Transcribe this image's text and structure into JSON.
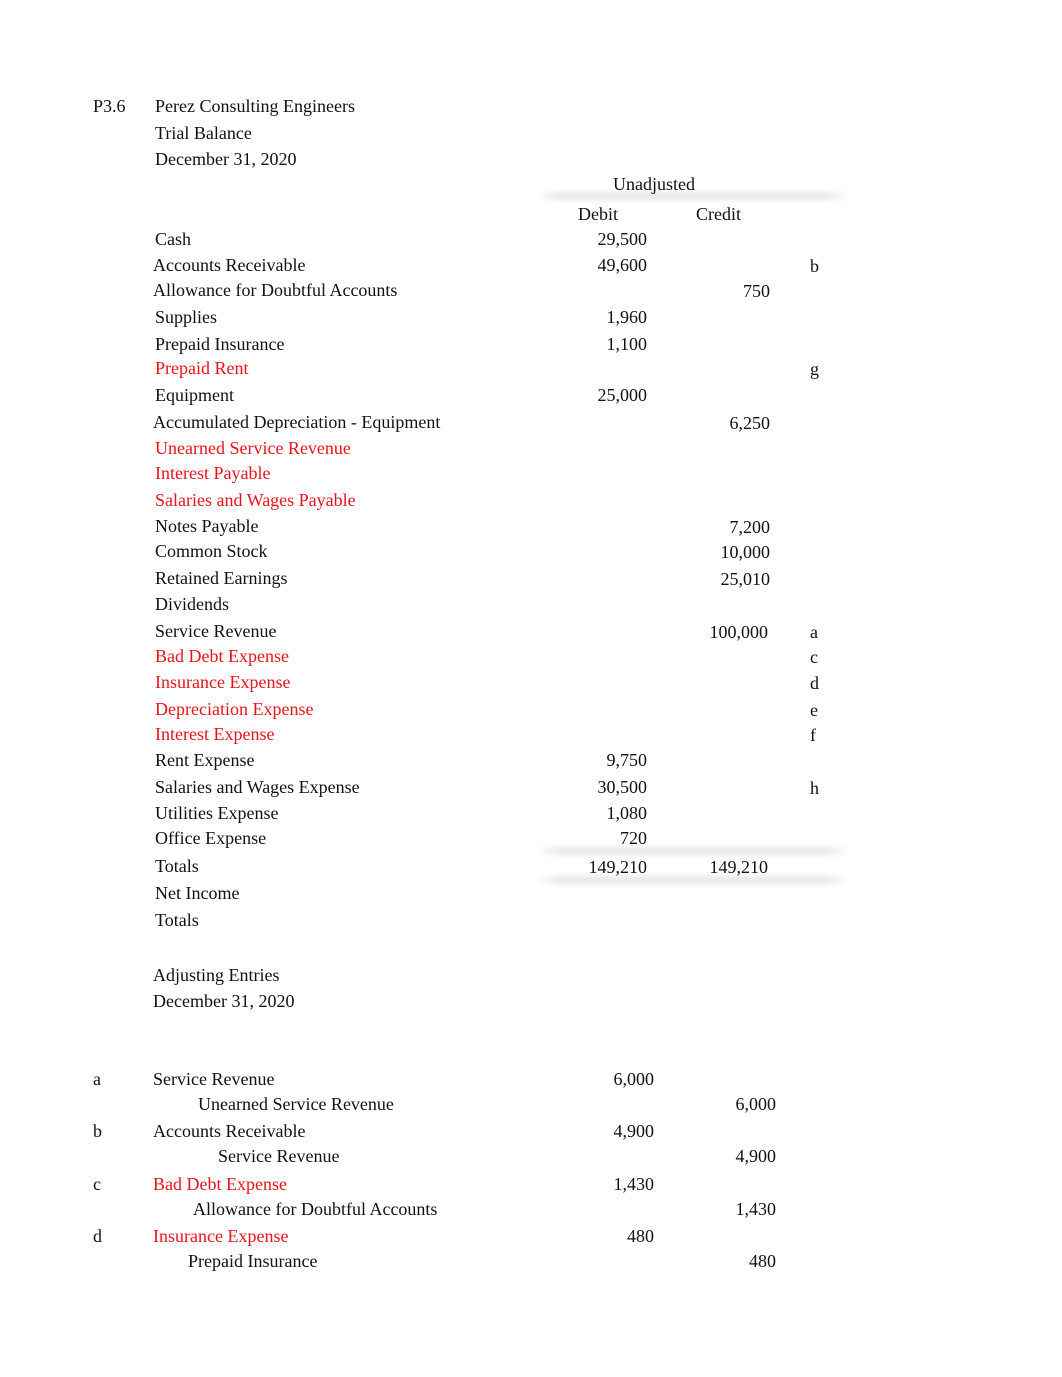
{
  "header": {
    "problem_id": "P3.6",
    "company": "Perez Consulting Engineers",
    "statement": "Trial Balance",
    "date": "December 31, 2020"
  },
  "trial_balance": {
    "group_header": "Unadjusted",
    "debit_header": "Debit",
    "credit_header": "Credit",
    "rows": [
      {
        "account": "Cash",
        "debit": "29,500",
        "credit": "",
        "ref": "",
        "highlight": false
      },
      {
        "account": "Accounts Receivable",
        "debit": "49,600",
        "credit": "",
        "ref": "b",
        "highlight": false
      },
      {
        "account": "Allowance for Doubtful Accounts",
        "debit": "",
        "credit": "750",
        "ref": "",
        "highlight": false
      },
      {
        "account": "Supplies",
        "debit": "1,960",
        "credit": "",
        "ref": "",
        "highlight": false
      },
      {
        "account": "Prepaid Insurance",
        "debit": "1,100",
        "credit": "",
        "ref": "",
        "highlight": false
      },
      {
        "account": "Prepaid Rent",
        "debit": "",
        "credit": "",
        "ref": "g",
        "highlight": true
      },
      {
        "account": "Equipment",
        "debit": "25,000",
        "credit": "",
        "ref": "",
        "highlight": false
      },
      {
        "account": "Accumulated Depreciation - Equipment",
        "debit": "",
        "credit": "6,250",
        "ref": "",
        "highlight": false
      },
      {
        "account": "Unearned Service Revenue",
        "debit": "",
        "credit": "",
        "ref": "",
        "highlight": true
      },
      {
        "account": "Interest Payable",
        "debit": "",
        "credit": "",
        "ref": "",
        "highlight": true
      },
      {
        "account": "Salaries and Wages Payable",
        "debit": "",
        "credit": "",
        "ref": "",
        "highlight": true
      },
      {
        "account": "Notes Payable",
        "debit": "",
        "credit": "7,200",
        "ref": "",
        "highlight": false
      },
      {
        "account": "Common Stock",
        "debit": "",
        "credit": "10,000",
        "ref": "",
        "highlight": false
      },
      {
        "account": "Retained Earnings",
        "debit": "",
        "credit": "25,010",
        "ref": "",
        "highlight": false
      },
      {
        "account": "Dividends",
        "debit": "",
        "credit": "",
        "ref": "",
        "highlight": false
      },
      {
        "account": "Service Revenue",
        "debit": "",
        "credit": "100,000",
        "ref": "a",
        "highlight": false
      },
      {
        "account": "Bad Debt Expense",
        "debit": "",
        "credit": "",
        "ref": "c",
        "highlight": true
      },
      {
        "account": "Insurance Expense",
        "debit": "",
        "credit": "",
        "ref": "d",
        "highlight": true
      },
      {
        "account": "Depreciation Expense",
        "debit": "",
        "credit": "",
        "ref": "e",
        "highlight": true
      },
      {
        "account": "Interest Expense",
        "debit": "",
        "credit": "",
        "ref": "f",
        "highlight": true
      },
      {
        "account": "Rent Expense",
        "debit": "9,750",
        "credit": "",
        "ref": "",
        "highlight": false
      },
      {
        "account": "Salaries and Wages Expense",
        "debit": "30,500",
        "credit": "",
        "ref": "h",
        "highlight": false
      },
      {
        "account": "Utilities Expense",
        "debit": "1,080",
        "credit": "",
        "ref": "",
        "highlight": false
      },
      {
        "account": "Office Expense",
        "debit": "720",
        "credit": "",
        "ref": "",
        "highlight": false
      }
    ],
    "totals_label": "Totals",
    "totals_debit": "149,210",
    "totals_credit": "149,210",
    "net_income_label": "Net Income",
    "final_totals_label": "Totals"
  },
  "adjusting_entries": {
    "title": "Adjusting Entries",
    "date": "December 31, 2020",
    "entries": [
      {
        "letter": "a",
        "debit_account": "Service Revenue",
        "debit_amount": "6,000",
        "credit_account": "Unearned Service Revenue",
        "credit_amount": "6,000",
        "highlight": false
      },
      {
        "letter": "b",
        "debit_account": "Accounts Receivable",
        "debit_amount": "4,900",
        "credit_account": "Service Revenue",
        "credit_amount": "4,900",
        "highlight": false
      },
      {
        "letter": "c",
        "debit_account": "Bad Debt Expense",
        "debit_amount": "1,430",
        "credit_account": "Allowance for Doubtful Accounts",
        "credit_amount": "1,430",
        "highlight": true
      },
      {
        "letter": "d",
        "debit_account": "Insurance Expense",
        "debit_amount": "480",
        "credit_account": "Prepaid Insurance",
        "credit_amount": "480",
        "highlight": true
      }
    ]
  }
}
